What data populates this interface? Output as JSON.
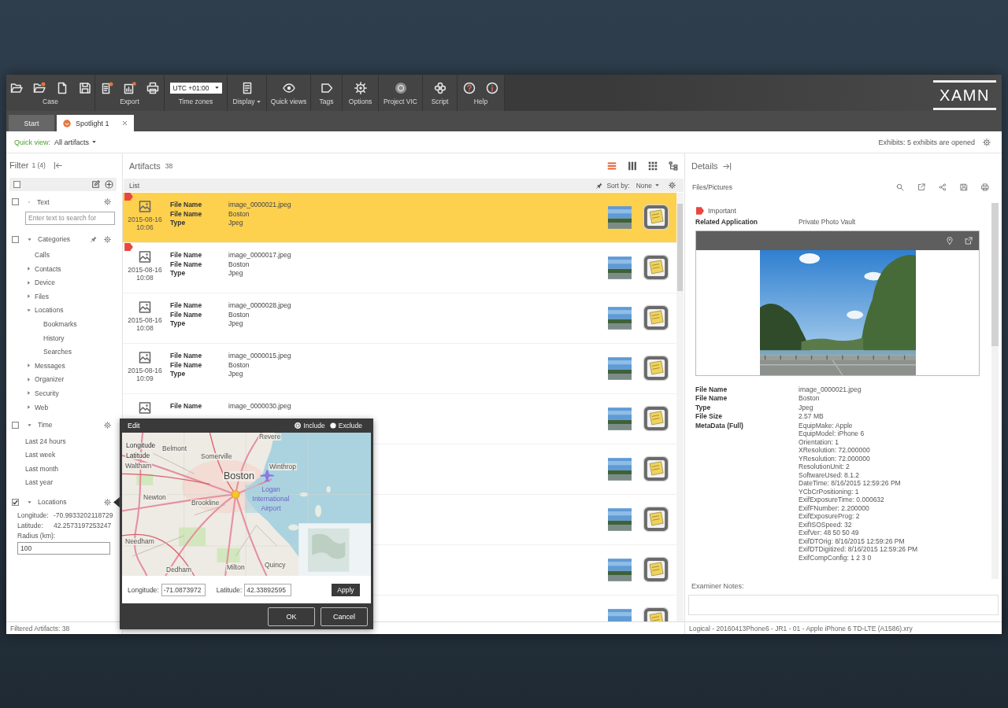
{
  "toolbar": {
    "groups": [
      {
        "kind": "icons",
        "label": "Case"
      },
      {
        "kind": "icons",
        "label": "Export"
      },
      {
        "kind": "select",
        "label": "Time zones",
        "value": "UTC +01:00"
      },
      {
        "kind": "menu",
        "label": "Display"
      },
      {
        "kind": "icons",
        "label": "Quick views"
      },
      {
        "kind": "icons",
        "label": "Tags"
      },
      {
        "kind": "icons",
        "label": "Options"
      },
      {
        "kind": "icons",
        "label": "Project VIC"
      },
      {
        "kind": "icons",
        "label": "Script"
      },
      {
        "kind": "icons",
        "label": "Help"
      }
    ],
    "logo": "XAMN"
  },
  "tabs": [
    {
      "label": "Start",
      "selected": false,
      "badge": false,
      "closable": false
    },
    {
      "label": "Spotlight 1",
      "selected": true,
      "badge": true,
      "closable": true
    }
  ],
  "quick_view": {
    "label": "Quick view:",
    "value": "All artifacts",
    "exhibits": "Exhibits: 5 exhibits are opened"
  },
  "filter": {
    "title": "Filter",
    "count": "1 (4)",
    "select_all": {
      "checked": false
    },
    "sections": [
      {
        "kind": "text",
        "label": "Text",
        "checked": false,
        "placeholder": "Enter text to search for"
      },
      {
        "kind": "tree",
        "label": "Categories",
        "checked": false,
        "expanded": true,
        "pinned": true,
        "items": [
          {
            "kind": "leaf",
            "label": "Calls"
          },
          {
            "kind": "branch",
            "label": "Contacts",
            "expanded": false
          },
          {
            "kind": "branch",
            "label": "Device",
            "expanded": false
          },
          {
            "kind": "branch",
            "label": "Files",
            "expanded": false
          },
          {
            "kind": "branch",
            "label": "Locations",
            "expanded": true,
            "children": [
              {
                "kind": "leaf",
                "label": "Bookmarks"
              },
              {
                "kind": "leaf",
                "label": "History"
              },
              {
                "kind": "leaf",
                "label": "Searches"
              }
            ]
          },
          {
            "kind": "branch",
            "label": "Messages",
            "expanded": false
          },
          {
            "kind": "branch",
            "label": "Organizer",
            "expanded": false
          },
          {
            "kind": "branch",
            "label": "Security",
            "expanded": false
          },
          {
            "kind": "branch",
            "label": "Web",
            "expanded": false
          }
        ]
      },
      {
        "kind": "list",
        "label": "Time",
        "checked": false,
        "expanded": true,
        "items": [
          "Last 24 hours",
          "Last week",
          "Last month",
          "Last year"
        ]
      },
      {
        "kind": "location",
        "label": "Locations",
        "checked": true,
        "expanded": true,
        "fields": [
          {
            "label": "Longitude:",
            "value": "-70.9933202118729"
          },
          {
            "label": "Latitude:",
            "value": "42.2573197253247"
          }
        ],
        "radius": {
          "label": "Radius (km):",
          "value": "100"
        }
      }
    ],
    "footer": "Filtered Artifacts: 38"
  },
  "artifacts": {
    "title": "Artifacts",
    "count": "38",
    "views": [
      {
        "selected": true
      },
      {
        "selected": false
      },
      {
        "selected": false
      },
      {
        "selected": false
      }
    ],
    "list_label": "List",
    "sort": {
      "label": "Sort by:",
      "value": "None"
    },
    "rows": [
      {
        "selected": true,
        "tagged": true,
        "date": "2015-08-16",
        "time": "10:06",
        "fields": [
          {
            "label": "File Name",
            "value": "image_0000021.jpeg"
          },
          {
            "label": "File Name",
            "value": "Boston"
          },
          {
            "label": "Type",
            "value": "Jpeg"
          }
        ]
      },
      {
        "selected": false,
        "tagged": true,
        "date": "2015-08-16",
        "time": "10:08",
        "fields": [
          {
            "label": "File Name",
            "value": "image_0000017.jpeg"
          },
          {
            "label": "File Name",
            "value": "Boston"
          },
          {
            "label": "Type",
            "value": "Jpeg"
          }
        ]
      },
      {
        "selected": false,
        "tagged": false,
        "date": "2015-08-16",
        "time": "10:08",
        "fields": [
          {
            "label": "File Name",
            "value": "image_0000028.jpeg"
          },
          {
            "label": "File Name",
            "value": "Boston"
          },
          {
            "label": "Type",
            "value": "Jpeg"
          }
        ]
      },
      {
        "selected": false,
        "tagged": false,
        "date": "2015-08-16",
        "time": "10:09",
        "fields": [
          {
            "label": "File Name",
            "value": "image_0000015.jpeg"
          },
          {
            "label": "File Name",
            "value": "Boston"
          },
          {
            "label": "Type",
            "value": "Jpeg"
          }
        ]
      },
      {
        "selected": false,
        "tagged": false,
        "fields": [
          {
            "label": "File Name",
            "value": "image_0000030.jpeg"
          }
        ]
      },
      {
        "selected": false,
        "tagged": false
      },
      {
        "selected": false,
        "tagged": false
      },
      {
        "selected": false,
        "tagged": false
      },
      {
        "selected": false,
        "tagged": false
      }
    ]
  },
  "details": {
    "title": "Details",
    "section": "Files/Pictures",
    "tag": "Important",
    "related": {
      "label": "Related Application",
      "value": "Private Photo Vault"
    },
    "fields": [
      {
        "label": "File Name",
        "value": "image_0000021.jpeg"
      },
      {
        "label": "File Name",
        "value": "Boston"
      },
      {
        "label": "Type",
        "value": "Jpeg"
      },
      {
        "label": "File Size",
        "value": "2.57 MB"
      }
    ],
    "metadata": {
      "label": "MetaData (Full)",
      "lines": [
        "EquipMake: Apple",
        "EquipModel: iPhone 6",
        "Orientation: 1",
        "XResolution: 72.000000",
        "YResolution: 72.000000",
        "ResolutionUnit: 2",
        "SoftwareUsed: 8.1.2",
        "DateTime: 8/16/2015 12:59:26 PM",
        "YCbCrPositioning: 1",
        "ExifExposureTime: 0.000632",
        "ExifFNumber: 2.200000",
        "ExifExposureProg: 2",
        "ExifISOSpeed: 32",
        "ExifVer: 48 50 50 49",
        "ExifDTOrig: 8/16/2015 12:59:26 PM",
        "ExifDTDigitized: 8/16/2015 12:59:26 PM",
        "ExifCompConfig: 1 2 3 0"
      ]
    },
    "notes_label": "Examiner Notes:",
    "footer": "Logical - 20160413Phone6 - JR1 - 01 - Apple iPhone 6 TD-LTE (A1586).xry"
  },
  "dialog": {
    "title": "Edit",
    "options": [
      {
        "label": "Include",
        "selected": true
      },
      {
        "label": "Exclude",
        "selected": false
      }
    ],
    "map_labels": [
      {
        "text": "Revere",
        "kind": "town"
      },
      {
        "text": "Longitude",
        "kind": "overlay"
      },
      {
        "text": "Belmont",
        "kind": "town"
      },
      {
        "text": "Latitude",
        "kind": "overlay"
      },
      {
        "text": "Somerville",
        "kind": "town"
      },
      {
        "text": "Waltham",
        "kind": "town"
      },
      {
        "text": "Winthrop",
        "kind": "town"
      },
      {
        "text": "Boston",
        "kind": "city"
      },
      {
        "text": "Newton",
        "kind": "town"
      },
      {
        "text": "Brookline",
        "kind": "town"
      },
      {
        "text": "Logan International Airport",
        "kind": "airport"
      },
      {
        "text": "Needham",
        "kind": "town"
      },
      {
        "text": "Dedham",
        "kind": "town"
      },
      {
        "text": "Milton",
        "kind": "town"
      },
      {
        "text": "Quincy",
        "kind": "town"
      }
    ],
    "longitude": {
      "label": "Longitude:",
      "value": "-71.0873972"
    },
    "latitude": {
      "label": "Latitude:",
      "value": "42.33892595"
    },
    "apply": "Apply",
    "buttons": [
      "OK",
      "Cancel"
    ]
  }
}
